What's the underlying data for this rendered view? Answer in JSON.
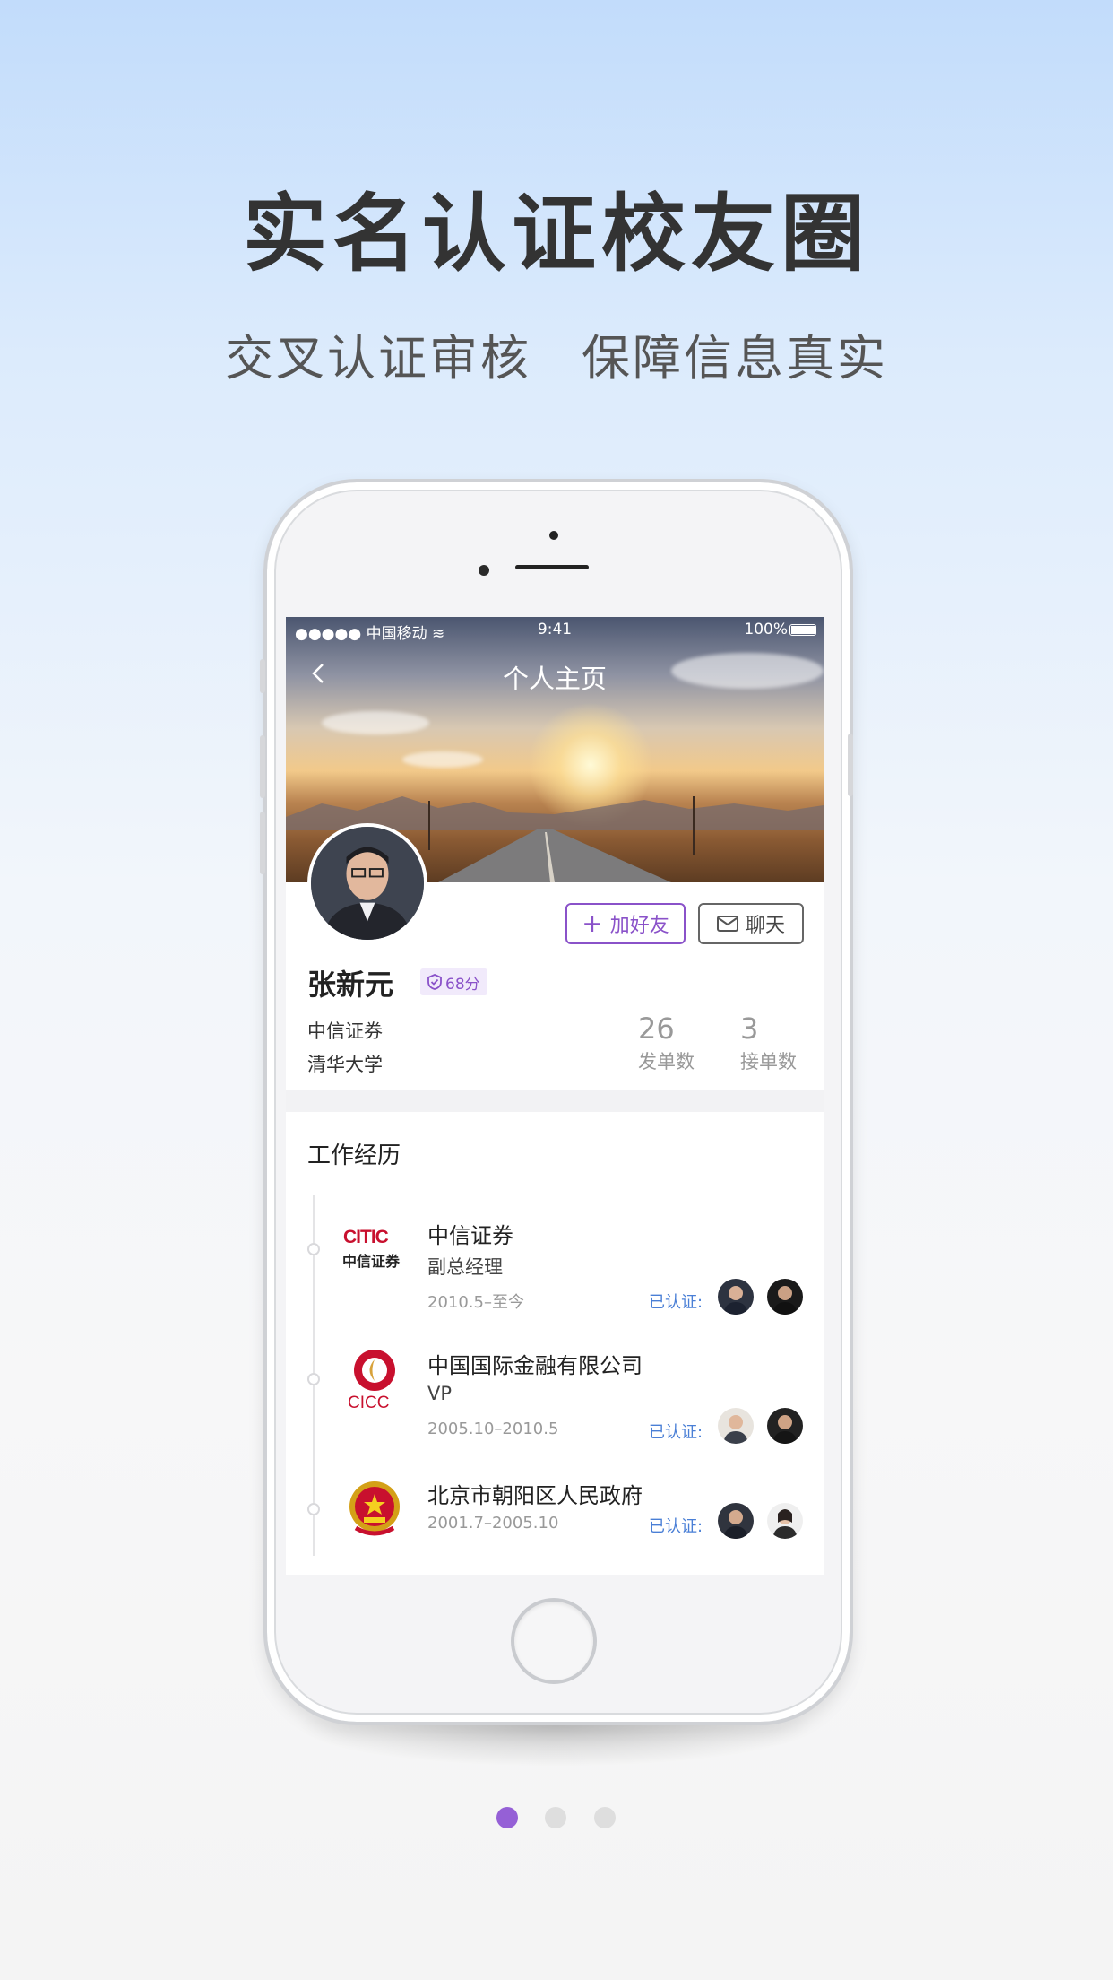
{
  "headline": {
    "title": "实名认证校友圈",
    "subtitle_left": "交叉认证审核",
    "subtitle_right": "保障信息真实"
  },
  "statusbar": {
    "carrier": "●●●●● 中国移动",
    "time": "9:41",
    "battery": "100%"
  },
  "navbar": {
    "title": "个人主页"
  },
  "profile": {
    "name": "张新元",
    "score": "68分",
    "company": "中信证券",
    "school": "清华大学",
    "add_friend": "加好友",
    "chat": "聊天",
    "stats": [
      {
        "value": "26",
        "label": "发单数"
      },
      {
        "value": "3",
        "label": "接单数"
      }
    ]
  },
  "work": {
    "title": "工作经历",
    "items": [
      {
        "logo_text_top": "CITIC",
        "logo_text_bottom": "中信证券",
        "company": "中信证券",
        "position": "副总经理",
        "period": "2010.5–至今",
        "verified": "已认证:"
      },
      {
        "logo_text_bottom": "CICC",
        "company": "中国国际金融有限公司",
        "position": "VP",
        "period": "2005.10–2010.5",
        "verified": "已认证:"
      },
      {
        "company": "北京市朝阳区人民政府",
        "period": "2001.7–2005.10",
        "verified": "已认证:"
      }
    ]
  },
  "pager": {
    "count": 3,
    "active": 0
  },
  "colors": {
    "accent": "#8a52c9",
    "verified": "#4a7fd6",
    "page_dot_active": "#9560d6"
  }
}
